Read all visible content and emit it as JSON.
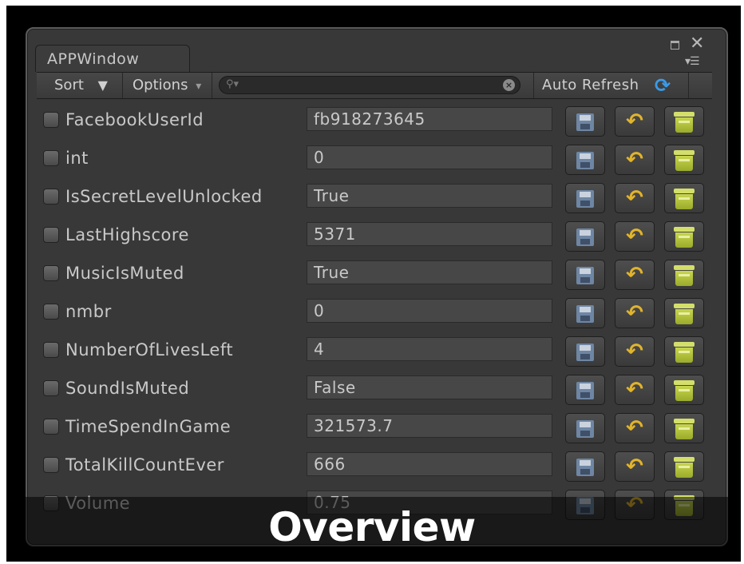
{
  "window": {
    "tab_title": "APPWindow"
  },
  "toolbar": {
    "sort_label": "Sort",
    "sort_arrow": "▼",
    "options_label": "Options",
    "options_arrow": "▾",
    "search_value": "",
    "auto_refresh_label": "Auto Refresh"
  },
  "icons": {
    "search": "search-icon",
    "clear": "clear-search-icon",
    "refresh": "refresh-icon",
    "save": "floppy-disk-icon",
    "undo": "undo-arrow-icon",
    "delete": "trash-icon"
  },
  "colors": {
    "window_bg": "#383838",
    "field_bg": "#474747",
    "refresh_blue": "#3a9ae8",
    "undo_yellow": "#e1b42c",
    "trash_green": "#c8d650",
    "save_blue": "#6e86a3"
  },
  "prefs": [
    {
      "key": "FacebookUserId",
      "value": "fb918273645"
    },
    {
      "key": "int",
      "value": "0"
    },
    {
      "key": "IsSecretLevelUnlocked",
      "value": "True"
    },
    {
      "key": "LastHighscore",
      "value": "5371"
    },
    {
      "key": "MusicIsMuted",
      "value": "True"
    },
    {
      "key": "nmbr",
      "value": "0"
    },
    {
      "key": "NumberOfLivesLeft",
      "value": "4"
    },
    {
      "key": "SoundIsMuted",
      "value": "False"
    },
    {
      "key": "TimeSpendInGame",
      "value": "321573.7"
    },
    {
      "key": "TotalKillCountEver",
      "value": "666"
    },
    {
      "key": "Volume",
      "value": "0.75"
    }
  ],
  "caption": "Overview"
}
